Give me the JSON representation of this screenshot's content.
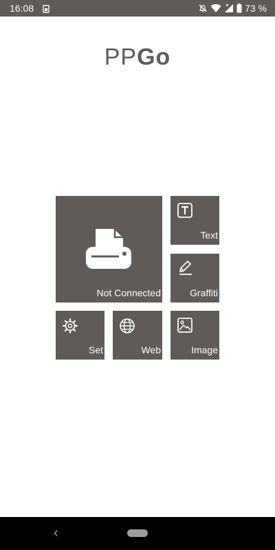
{
  "status": {
    "time": "16:08",
    "battery": "73 %",
    "icons": [
      "sim-card-icon",
      "bell-off-icon",
      "wifi-icon",
      "signal-icon",
      "battery-icon"
    ]
  },
  "logo": {
    "part1": "PP",
    "part2": "Go"
  },
  "tiles": {
    "connection": {
      "label": "Not Connected",
      "icon": "printer-icon"
    },
    "text": {
      "label": "Text",
      "icon": "text-icon"
    },
    "graffiti": {
      "label": "Graffiti",
      "icon": "pencil-icon"
    },
    "settings": {
      "label": "Set",
      "icon": "gear-icon"
    },
    "web": {
      "label": "Web",
      "icon": "globe-icon"
    },
    "image": {
      "label": "Image",
      "icon": "image-icon"
    }
  },
  "navbar": {
    "back_icon": "back-chevron-icon",
    "home_icon": "home-pill-icon"
  },
  "colors": {
    "tile": "#5e5b58",
    "statusbar": "#5e5b58",
    "background": "#ffffff",
    "navbar": "#000000"
  }
}
